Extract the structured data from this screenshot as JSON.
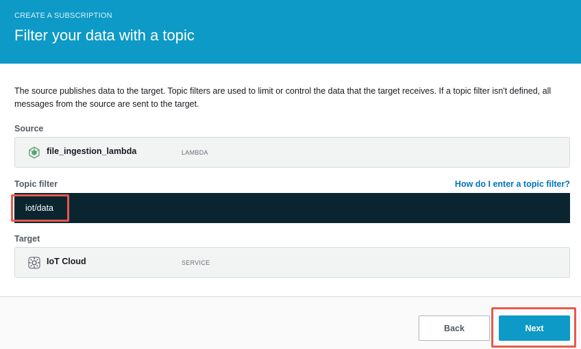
{
  "header": {
    "kicker": "CREATE A SUBSCRIPTION",
    "title": "Filter your data with a topic",
    "background_color": "#0e9ac6"
  },
  "description": "The source publishes data to the target. Topic filters are used to limit or control the data that the target receives. If a topic filter isn't defined, all messages from the source are sent to the target.",
  "source": {
    "label": "Source",
    "name": "file_ingestion_lambda",
    "type": "LAMBDA",
    "icon": "lambda-function-icon"
  },
  "topic_filter": {
    "label": "Topic filter",
    "help_link": "How do I enter a topic filter?",
    "value": "iot/data",
    "background_color": "#0b2530"
  },
  "target": {
    "label": "Target",
    "name": "IoT Cloud",
    "type": "SERVICE",
    "icon": "iot-cloud-icon"
  },
  "footer": {
    "back_label": "Back",
    "next_label": "Next"
  },
  "highlight_color": "#e8594a"
}
